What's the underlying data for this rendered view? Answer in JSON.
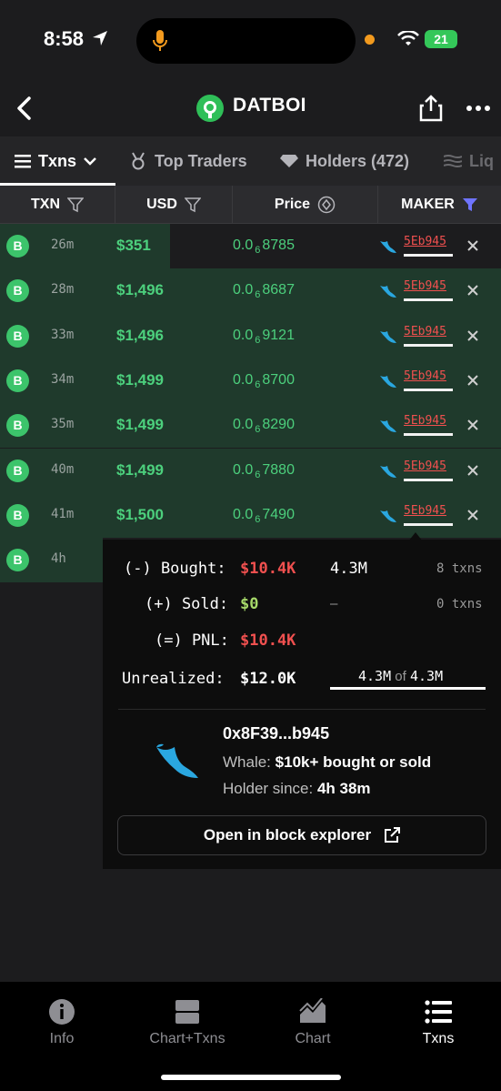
{
  "status_bar": {
    "time": "8:58",
    "battery": "21"
  },
  "header": {
    "token_name": "DATBOI"
  },
  "tabs": [
    {
      "label": "Txns"
    },
    {
      "label": "Top Traders"
    },
    {
      "label": "Holders (472)"
    },
    {
      "label": "Liq"
    }
  ],
  "columns": {
    "txn": "TXN",
    "usd": "USD",
    "price": "Price",
    "maker": "MAKER"
  },
  "rows": [
    {
      "type": "B",
      "age": "26m",
      "usd": "$351",
      "price_prefix": "0.0",
      "price_zeros": "6",
      "price_digits": "8785",
      "maker": "5Eb945"
    },
    {
      "type": "B",
      "age": "28m",
      "usd": "$1,496",
      "price_prefix": "0.0",
      "price_zeros": "6",
      "price_digits": "8687",
      "maker": "5Eb945"
    },
    {
      "type": "B",
      "age": "33m",
      "usd": "$1,496",
      "price_prefix": "0.0",
      "price_zeros": "6",
      "price_digits": "9121",
      "maker": "5Eb945"
    },
    {
      "type": "B",
      "age": "34m",
      "usd": "$1,499",
      "price_prefix": "0.0",
      "price_zeros": "6",
      "price_digits": "8700",
      "maker": "5Eb945"
    },
    {
      "type": "B",
      "age": "35m",
      "usd": "$1,499",
      "price_prefix": "0.0",
      "price_zeros": "6",
      "price_digits": "8290",
      "maker": "5Eb945"
    },
    {
      "type": "B",
      "age": "40m",
      "usd": "$1,499",
      "price_prefix": "0.0",
      "price_zeros": "6",
      "price_digits": "7880",
      "maker": "5Eb945"
    },
    {
      "type": "B",
      "age": "41m",
      "usd": "$1,500",
      "price_prefix": "0.0",
      "price_zeros": "6",
      "price_digits": "7490",
      "maker": "5Eb945"
    },
    {
      "type": "B",
      "age": "4h"
    }
  ],
  "popover": {
    "bought_label": "(-) Bought:",
    "bought_usd": "$10.4K",
    "bought_amount": "4.3M",
    "bought_txns": "8 txns",
    "sold_label": "(+) Sold:",
    "sold_usd": "$0",
    "sold_amount": "–",
    "sold_txns": "0 txns",
    "pnl_label": "(=) PNL:",
    "pnl_usd": "$10.4K",
    "unrealized_label": "Unrealized:",
    "unrealized_usd": "$12.0K",
    "holding_amount": "4.3M",
    "holding_of": "of",
    "holding_total": "4.3M",
    "address": "0x8F39...b945",
    "whale_label": "Whale:",
    "whale_value": "$10k+ bought or sold",
    "holder_label": "Holder since:",
    "holder_value": "4h 38m",
    "explorer_label": "Open in block explorer"
  },
  "bottom_nav": [
    {
      "label": "Info"
    },
    {
      "label": "Chart+Txns"
    },
    {
      "label": "Chart"
    },
    {
      "label": "Txns"
    }
  ],
  "colors": {
    "buy_green": "#4cd07d",
    "sell_red": "#f0504f",
    "row_bg": "#1f3a2c",
    "filter_active": "#6f74ff"
  }
}
